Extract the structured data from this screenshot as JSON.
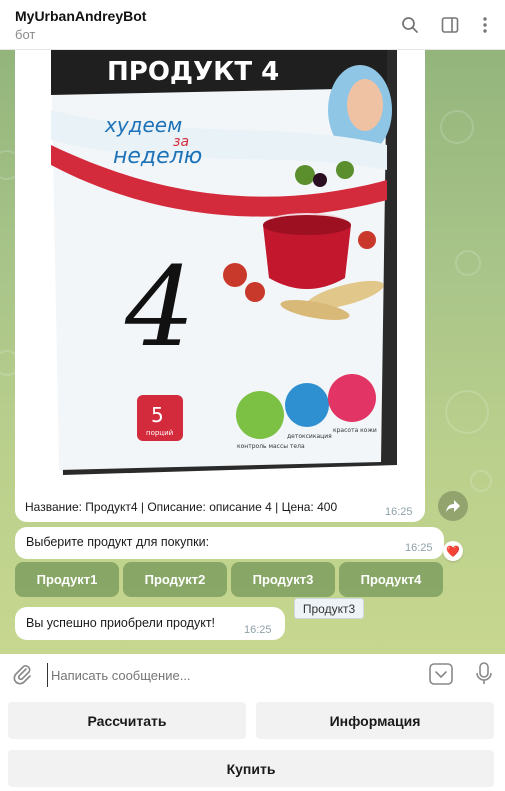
{
  "header": {
    "title": "MyUrbanAndreyBot",
    "subtitle": "бот"
  },
  "icons": {
    "search": "search-icon",
    "sidebar": "sidebar-toggle-icon",
    "menu": "more-vertical-icon",
    "share": "share-icon",
    "attach": "paperclip-icon",
    "keyboard": "keyboard-toggle-icon",
    "mic": "microphone-icon"
  },
  "messages": {
    "product_photo": {
      "package_title": "ПРОДУКТ 4",
      "slogan_line1": "худеем",
      "slogan_line2": "за",
      "slogan_line3": "неделю",
      "big_number": "4",
      "portions_number": "5",
      "portions_label": "порций",
      "feature1": "контроль массы тела",
      "feature2": "детоксикация",
      "feature3": "красота кожи",
      "caption": "Название: Продукт4 | Описание: описание 4 | Цена: 400",
      "time": "16:25"
    },
    "choose": {
      "text": "Выберите продукт для покупки:",
      "time": "16:25",
      "reaction": "❤️"
    },
    "inline_buttons": [
      "Продукт1",
      "Продукт2",
      "Продукт3",
      "Продукт4"
    ],
    "tooltip": "Продукт3",
    "success": {
      "text": "Вы успешно приобрели продукт!",
      "time": "16:25"
    }
  },
  "input": {
    "placeholder": "Написать сообщение..."
  },
  "reply_keyboard": {
    "calculate": "Рассчитать",
    "info": "Информация",
    "buy": "Купить"
  },
  "colors": {
    "chat_bg": "#a8c489",
    "inline_button_bg": "#6d9a59",
    "package_red": "#d42b3c"
  }
}
